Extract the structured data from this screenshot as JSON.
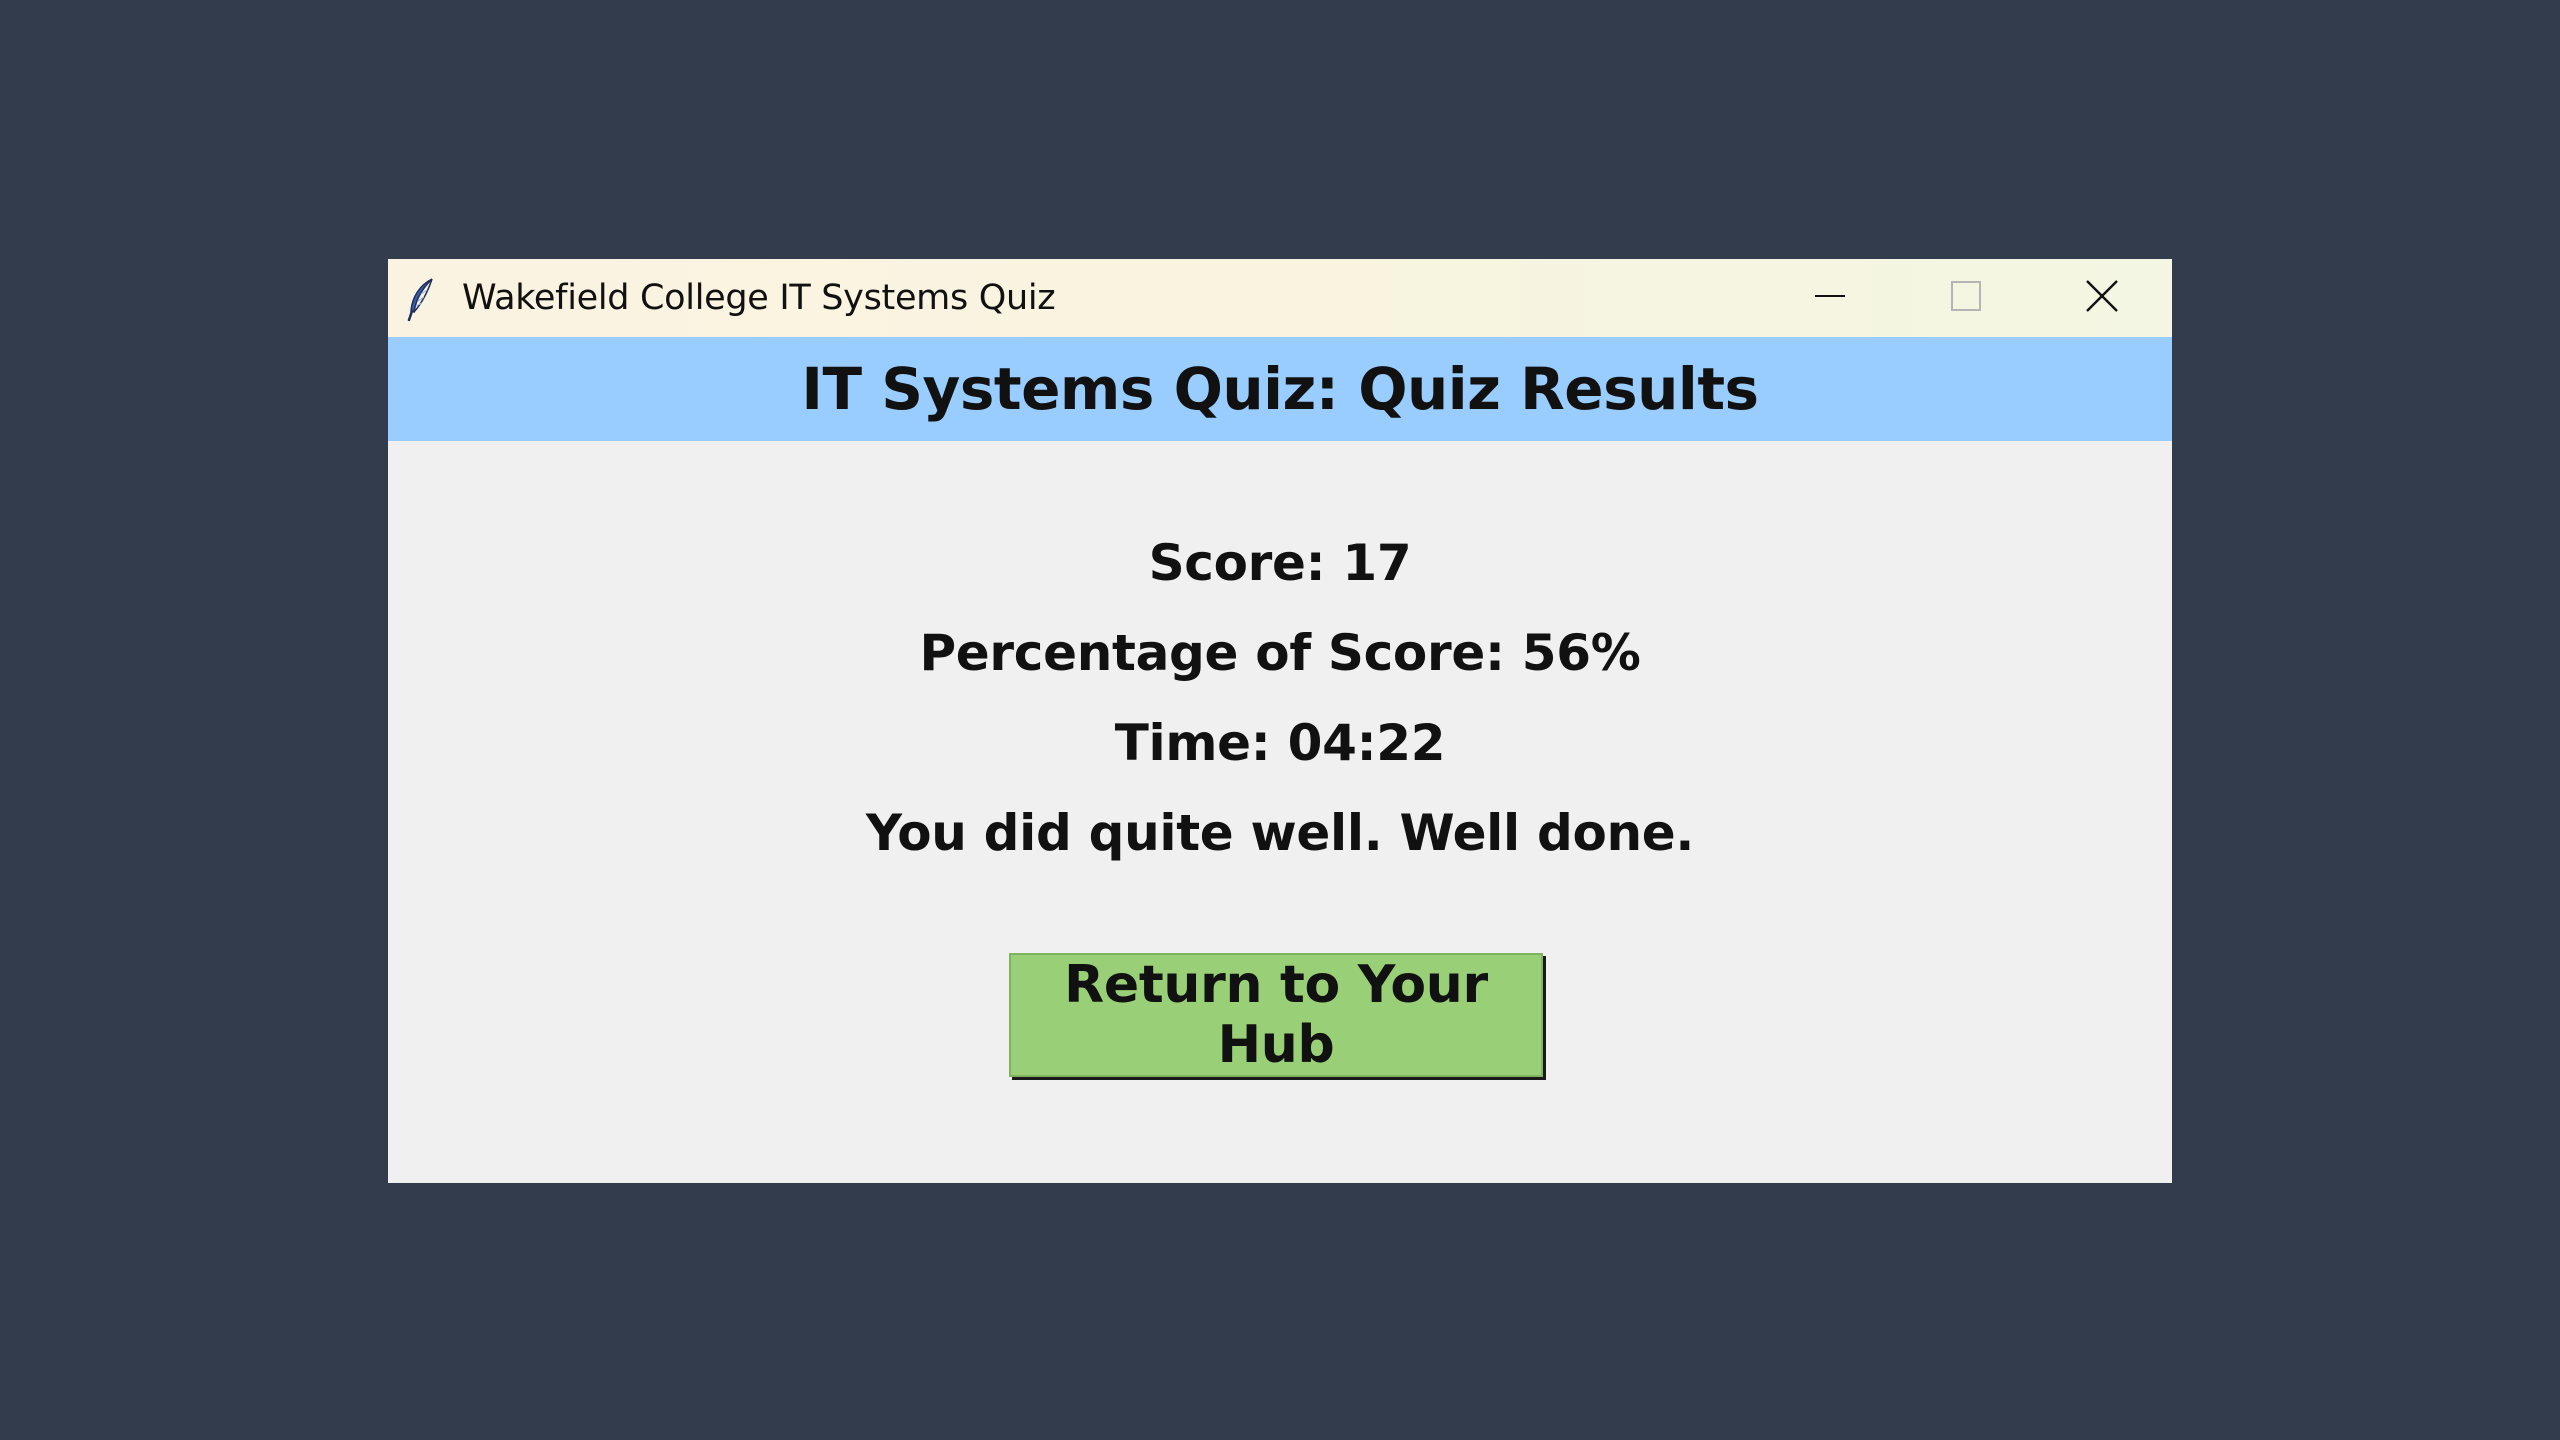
{
  "window": {
    "title": "Wakefield College IT Systems Quiz",
    "icon": "feather-icon",
    "controls": {
      "minimize_icon": "minimize-icon",
      "maximize_icon": "maximize-icon",
      "close_icon": "close-icon"
    }
  },
  "header": {
    "title": "IT Systems Quiz: Quiz Results",
    "background_color": "#99ccff"
  },
  "results": {
    "score_text": "Score: 17",
    "percentage_text": "Percentage of Score: 56%",
    "time_text": "Time: 04:22",
    "message": "You did quite well. Well done."
  },
  "actions": {
    "return_label": "Return to Your Hub",
    "button_color": "#99d077"
  }
}
